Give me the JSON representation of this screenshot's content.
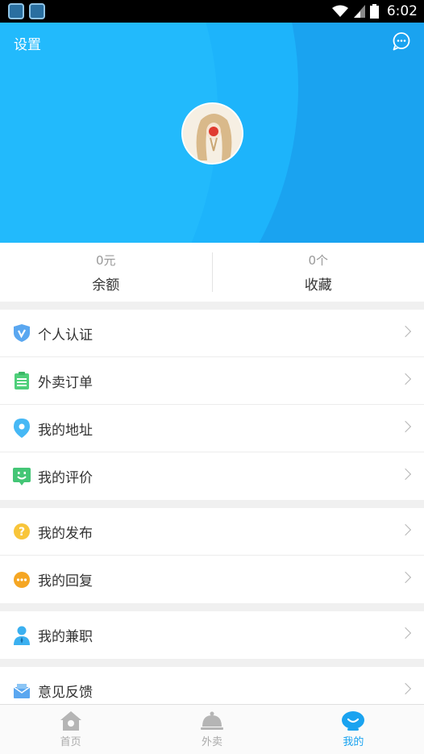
{
  "status_bar": {
    "time": "6:02"
  },
  "header": {
    "settings_label": "设置"
  },
  "stats": [
    {
      "value": "0元",
      "label": "余额"
    },
    {
      "value": "0个",
      "label": "收藏"
    }
  ],
  "menu_groups": [
    {
      "items": [
        {
          "label": "个人认证",
          "icon": "verified-shield-icon",
          "color": "#5aa7f0"
        },
        {
          "label": "外卖订单",
          "icon": "order-list-icon",
          "color": "#4fcf7a"
        },
        {
          "label": "我的地址",
          "icon": "location-pin-icon",
          "color": "#46b8f5"
        },
        {
          "label": "我的评价",
          "icon": "smile-review-icon",
          "color": "#44c676"
        }
      ]
    },
    {
      "items": [
        {
          "label": "我的发布",
          "icon": "question-icon",
          "color": "#f8c53a"
        },
        {
          "label": "我的回复",
          "icon": "reply-bubble-icon",
          "color": "#f5a623"
        }
      ]
    },
    {
      "items": [
        {
          "label": "我的兼职",
          "icon": "person-icon",
          "color": "#3bb0f0"
        }
      ]
    },
    {
      "items": [
        {
          "label": "意见反馈",
          "icon": "feedback-mail-icon",
          "color": "#5aa7f0"
        }
      ]
    }
  ],
  "tabbar": {
    "items": [
      {
        "label": "首页",
        "icon": "home-icon",
        "active": false
      },
      {
        "label": "外卖",
        "icon": "food-cloche-icon",
        "active": false
      },
      {
        "label": "我的",
        "icon": "profile-face-icon",
        "active": true
      }
    ],
    "active_color": "#1aa3f0"
  },
  "colors": {
    "header_blue": "#1aa3f0",
    "header_light": "#22bafc"
  }
}
